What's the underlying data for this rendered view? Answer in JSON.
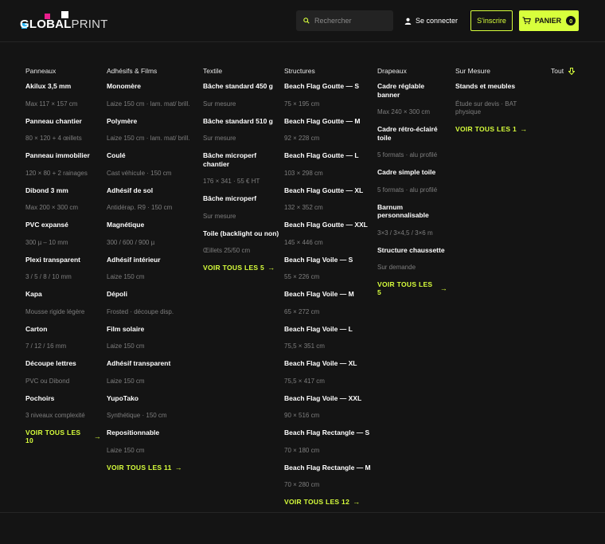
{
  "colors": {
    "accent": "#d8ff3c",
    "background": "#141414",
    "muted": "#7e7e7e"
  },
  "header": {
    "logo": {
      "text_bold": "GLOBAL",
      "text_thin": "PRINT"
    },
    "search": {
      "placeholder": "Rechercher",
      "icon": "search-icon"
    },
    "login_label": "Se connecter",
    "signup_label": "S'inscrire",
    "cart": {
      "label": "PANIER",
      "count": "0",
      "icon": "cart-icon"
    }
  },
  "menu": {
    "tout_label": "Tout",
    "columns": [
      {
        "title": "Panneaux",
        "items": [
          {
            "name": "Akilux 3,5 mm",
            "desc": "Max 117 × 157 cm"
          },
          {
            "name": "Panneau chantier",
            "desc": "80 × 120 + 4 œillets"
          },
          {
            "name": "Panneau immobilier",
            "desc": "120 × 80 + 2 rainages"
          },
          {
            "name": "Dibond 3 mm",
            "desc": "Max 200 × 300 cm"
          },
          {
            "name": "PVC expansé",
            "desc": "300 µ – 10 mm"
          },
          {
            "name": "Plexi transparent",
            "desc": "3 / 5 / 8 / 10 mm"
          },
          {
            "name": "Kapa",
            "desc": "Mousse rigide légère"
          },
          {
            "name": "Carton",
            "desc": "7 / 12 / 16 mm"
          },
          {
            "name": "Découpe lettres",
            "desc": "PVC ou Dibond"
          },
          {
            "name": "Pochoirs",
            "desc": "3 niveaux complexité"
          }
        ],
        "see_all": "VOIR TOUS LES 10"
      },
      {
        "title": "Adhésifs & Films",
        "items": [
          {
            "name": "Monomère",
            "desc": "Laize 150 cm · lam. mat/ brill."
          },
          {
            "name": "Polymère",
            "desc": "Laize 150 cm · lam. mat/ brill."
          },
          {
            "name": "Coulé",
            "desc": "Cast véhicule · 150 cm"
          },
          {
            "name": "Adhésif de sol",
            "desc": "Antidérap. R9 · 150 cm"
          },
          {
            "name": "Magnétique",
            "desc": "300 / 600 / 900 µ"
          },
          {
            "name": "Adhésif intérieur",
            "desc": "Laize 150 cm"
          },
          {
            "name": "Dépoli",
            "desc": "Frosted · découpe disp."
          },
          {
            "name": "Film solaire",
            "desc": "Laize 150 cm"
          },
          {
            "name": "Adhésif transparent",
            "desc": "Laize 150 cm"
          },
          {
            "name": "YupoTako",
            "desc": "Synthétique · 150 cm"
          },
          {
            "name": "Repositionnable",
            "desc": "Laize 150 cm"
          }
        ],
        "see_all": "VOIR TOUS LES 11"
      },
      {
        "title": "Textile",
        "items": [
          {
            "name": "Bâche standard 450 g",
            "desc": "Sur mesure"
          },
          {
            "name": "Bâche standard 510 g",
            "desc": "Sur mesure"
          },
          {
            "name": "Bâche microperf chantier",
            "desc": "176 × 341 · 55 € HT"
          },
          {
            "name": "Bâche microperf",
            "desc": "Sur mesure"
          },
          {
            "name": "Toile (backlight ou non)",
            "desc": "Œillets 25/50 cm"
          }
        ],
        "see_all": "VOIR TOUS LES 5"
      },
      {
        "title": "Structures",
        "items": [
          {
            "name": "Beach Flag Goutte — S",
            "desc": "75 × 195 cm"
          },
          {
            "name": "Beach Flag Goutte — M",
            "desc": "92 × 228 cm"
          },
          {
            "name": "Beach Flag Goutte — L",
            "desc": "103 × 298 cm"
          },
          {
            "name": "Beach Flag Goutte — XL",
            "desc": "132 × 352 cm"
          },
          {
            "name": "Beach Flag Goutte — XXL",
            "desc": "145 × 446 cm"
          },
          {
            "name": "Beach Flag Voile — S",
            "desc": "55 × 226 cm"
          },
          {
            "name": "Beach Flag Voile — M",
            "desc": "65 × 272 cm"
          },
          {
            "name": "Beach Flag Voile — L",
            "desc": "75,5 × 351 cm"
          },
          {
            "name": "Beach Flag Voile — XL",
            "desc": "75,5 × 417 cm"
          },
          {
            "name": "Beach Flag Voile — XXL",
            "desc": "90 × 516 cm"
          },
          {
            "name": "Beach Flag Rectangle — S",
            "desc": "70 × 180 cm"
          },
          {
            "name": "Beach Flag Rectangle — M",
            "desc": "70 × 280 cm"
          }
        ],
        "see_all": "VOIR TOUS LES 12"
      },
      {
        "title": "Drapeaux",
        "items": [
          {
            "name": "Cadre réglable banner",
            "desc": "Max 240 × 300 cm"
          },
          {
            "name": "Cadre rétro-éclairé toile",
            "desc": "5 formats · alu profilé"
          },
          {
            "name": "Cadre simple toile",
            "desc": "5 formats · alu profilé"
          },
          {
            "name": "Barnum personnalisable",
            "desc": "3×3 / 3×4,5 / 3×6 m"
          },
          {
            "name": "Structure chaussette",
            "desc": "Sur demande"
          }
        ],
        "see_all": "VOIR TOUS LES 5"
      },
      {
        "title": "Sur Mesure",
        "items": [
          {
            "name": "Stands et meubles",
            "desc": "Étude sur devis · BAT physique"
          }
        ],
        "see_all": "VOIR TOUS LES 1"
      }
    ]
  }
}
